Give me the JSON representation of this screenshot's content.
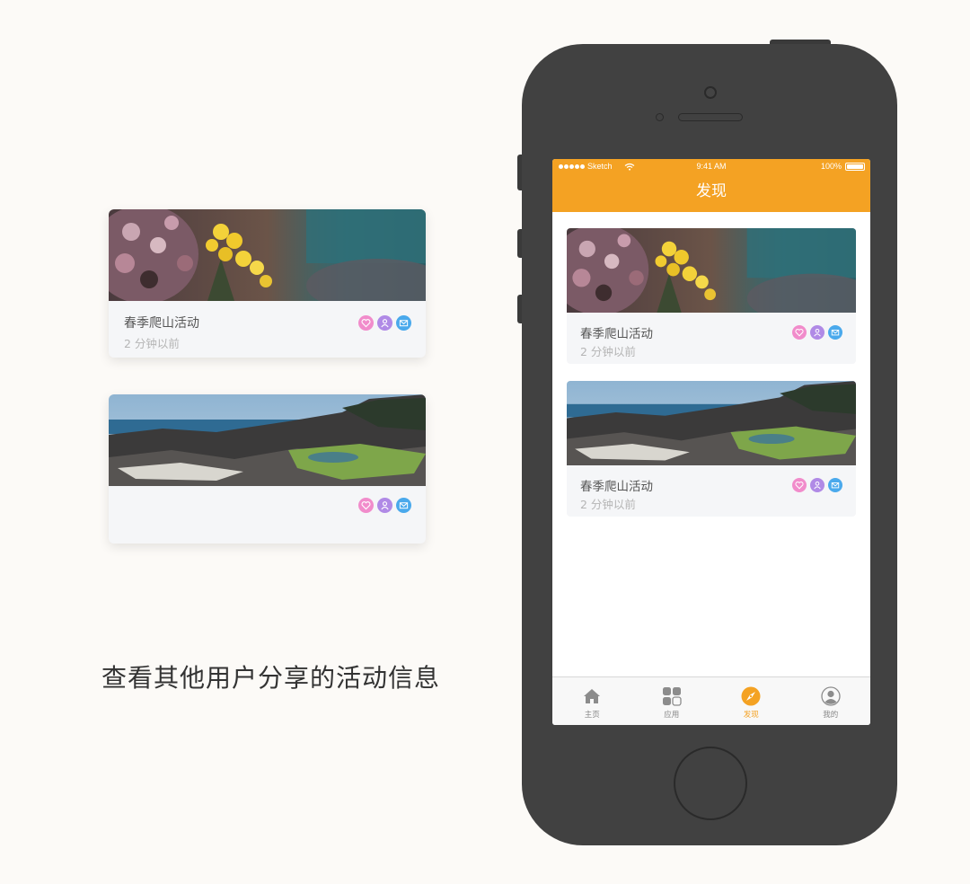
{
  "left_cards": [
    {
      "title": "春季爬山活动",
      "time": "2 分钟以前",
      "image": "flower-photo"
    },
    {
      "title": "",
      "time": "",
      "image": "rocky-coast-photo"
    }
  ],
  "caption": "查看其他用户分享的活动信息",
  "phone": {
    "status_bar": {
      "carrier": "Sketch",
      "time": "9:41 AM",
      "battery": "100%"
    },
    "nav_title": "发现",
    "cards": [
      {
        "title": "春季爬山活动",
        "time": "2 分钟以前",
        "image": "flower-photo"
      },
      {
        "title": "春季爬山活动",
        "time": "2 分钟以前",
        "image": "rocky-coast-photo"
      }
    ],
    "tabs": [
      {
        "label": "主页",
        "icon": "home-icon"
      },
      {
        "label": "应用",
        "icon": "apps-icon"
      },
      {
        "label": "发现",
        "icon": "compass-icon",
        "active": true
      },
      {
        "label": "我的",
        "icon": "profile-icon"
      }
    ]
  },
  "card_action_icons": [
    "heart-icon",
    "user-icon",
    "mail-icon"
  ],
  "colors": {
    "accent": "#f4a223",
    "heart": "#f18ccb",
    "user": "#b08ae6",
    "mail": "#4aa9ec",
    "phone_body": "#414141",
    "background": "#fcfaf7"
  }
}
